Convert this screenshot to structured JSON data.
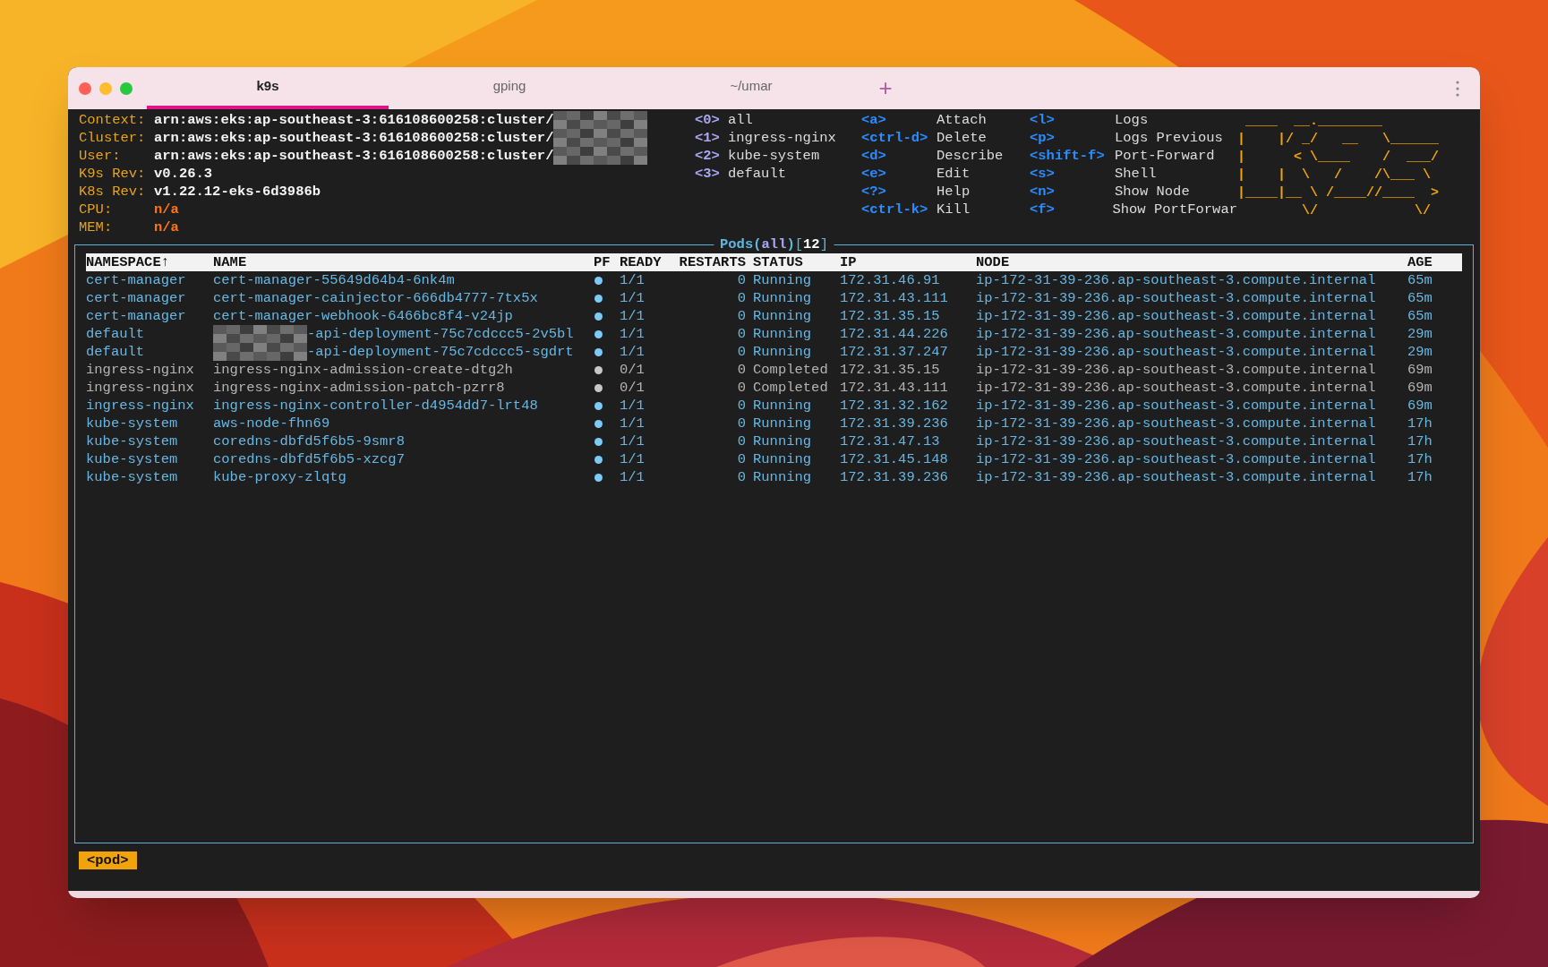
{
  "tabs": [
    {
      "label": "k9s",
      "selected": true
    },
    {
      "label": "gping",
      "selected": false
    },
    {
      "label": "~/umar",
      "selected": false
    }
  ],
  "new_tab": "+",
  "info": [
    {
      "label": "Context:",
      "value": "arn:aws:eks:ap-southeast-3:616108600258:cluster/",
      "kind": "plain",
      "redacted": true
    },
    {
      "label": "Cluster:",
      "value": "arn:aws:eks:ap-southeast-3:616108600258:cluster/",
      "kind": "plain",
      "redacted": true
    },
    {
      "label": "User:",
      "value": "arn:aws:eks:ap-southeast-3:616108600258:cluster/",
      "kind": "plain",
      "redacted": true
    },
    {
      "label": "K9s Rev:",
      "value": "v0.26.3",
      "kind": "plain",
      "redacted": false
    },
    {
      "label": "K8s Rev:",
      "value": "v1.22.12-eks-6d3986b",
      "kind": "plain",
      "redacted": false
    },
    {
      "label": "CPU:",
      "value": "n/a",
      "kind": "metric",
      "redacted": false
    },
    {
      "label": "MEM:",
      "value": "n/a",
      "kind": "metric",
      "redacted": false
    }
  ],
  "namespaces": [
    {
      "key": "<0>",
      "name": "all"
    },
    {
      "key": "<1>",
      "name": "ingress-nginx"
    },
    {
      "key": "<2>",
      "name": "kube-system"
    },
    {
      "key": "<3>",
      "name": "default"
    }
  ],
  "shortcuts": [
    [
      {
        "key": "<a>",
        "action": "Attach"
      },
      {
        "key": "<ctrl-d>",
        "action": "Delete"
      },
      {
        "key": "<d>",
        "action": "Describe"
      },
      {
        "key": "<e>",
        "action": "Edit"
      },
      {
        "key": "<?>",
        "action": "Help"
      },
      {
        "key": "<ctrl-k>",
        "action": "Kill"
      }
    ],
    [
      {
        "key": "<l>",
        "action": "Logs"
      },
      {
        "key": "<p>",
        "action": "Logs Previous"
      },
      {
        "key": "<shift-f>",
        "action": "Port-Forward"
      },
      {
        "key": "<s>",
        "action": "Shell"
      },
      {
        "key": "<n>",
        "action": "Show Node"
      },
      {
        "key": "<f>",
        "action": "Show PortForwar"
      }
    ]
  ],
  "logo": [
    " ____  __.________       ",
    "|    |/ _/   __   \\______ ",
    "|      < \\____    /  ___/ ",
    "|    |  \\   /    /\\___ \\  ",
    "|____|__ \\ /____//____  > ",
    "        \\/            \\/  "
  ],
  "pods": {
    "title": [
      {
        "text": "Pods",
        "kind": "name"
      },
      {
        "text": "(",
        "kind": "bracket"
      },
      {
        "text": "all",
        "kind": "filter"
      },
      {
        "text": ")",
        "kind": "bracket"
      },
      {
        "text": "[",
        "kind": "plain"
      },
      {
        "text": "12",
        "kind": "count"
      },
      {
        "text": "]",
        "kind": "plain"
      }
    ],
    "columns": [
      "NAMESPACE↑",
      "NAME",
      "PF",
      "READY",
      "RESTARTS",
      "STATUS",
      "IP",
      "NODE",
      "AGE"
    ],
    "rows": [
      {
        "namespace": "cert-manager",
        "name": "cert-manager-55649d64b4-6nk4m",
        "name_redacted": false,
        "ready": "1/1",
        "restarts": "0",
        "status": "Running",
        "ip": "172.31.46.91",
        "node": "ip-172-31-39-236.ap-southeast-3.compute.internal",
        "age": "65m",
        "completed": false
      },
      {
        "namespace": "cert-manager",
        "name": "cert-manager-cainjector-666db4777-7tx5x",
        "name_redacted": false,
        "ready": "1/1",
        "restarts": "0",
        "status": "Running",
        "ip": "172.31.43.111",
        "node": "ip-172-31-39-236.ap-southeast-3.compute.internal",
        "age": "65m",
        "completed": false
      },
      {
        "namespace": "cert-manager",
        "name": "cert-manager-webhook-6466bc8f4-v24jp",
        "name_redacted": false,
        "ready": "1/1",
        "restarts": "0",
        "status": "Running",
        "ip": "172.31.35.15",
        "node": "ip-172-31-39-236.ap-southeast-3.compute.internal",
        "age": "65m",
        "completed": false
      },
      {
        "namespace": "default",
        "name": "-api-deployment-75c7cdccc5-2v5bl",
        "name_redacted": true,
        "ready": "1/1",
        "restarts": "0",
        "status": "Running",
        "ip": "172.31.44.226",
        "node": "ip-172-31-39-236.ap-southeast-3.compute.internal",
        "age": "29m",
        "completed": false
      },
      {
        "namespace": "default",
        "name": "-api-deployment-75c7cdccc5-sgdrt",
        "name_redacted": true,
        "ready": "1/1",
        "restarts": "0",
        "status": "Running",
        "ip": "172.31.37.247",
        "node": "ip-172-31-39-236.ap-southeast-3.compute.internal",
        "age": "29m",
        "completed": false
      },
      {
        "namespace": "ingress-nginx",
        "name": "ingress-nginx-admission-create-dtg2h",
        "name_redacted": false,
        "ready": "0/1",
        "restarts": "0",
        "status": "Completed",
        "ip": "172.31.35.15",
        "node": "ip-172-31-39-236.ap-southeast-3.compute.internal",
        "age": "69m",
        "completed": true
      },
      {
        "namespace": "ingress-nginx",
        "name": "ingress-nginx-admission-patch-pzrr8",
        "name_redacted": false,
        "ready": "0/1",
        "restarts": "0",
        "status": "Completed",
        "ip": "172.31.43.111",
        "node": "ip-172-31-39-236.ap-southeast-3.compute.internal",
        "age": "69m",
        "completed": true
      },
      {
        "namespace": "ingress-nginx",
        "name": "ingress-nginx-controller-d4954dd7-lrt48",
        "name_redacted": false,
        "ready": "1/1",
        "restarts": "0",
        "status": "Running",
        "ip": "172.31.32.162",
        "node": "ip-172-31-39-236.ap-southeast-3.compute.internal",
        "age": "69m",
        "completed": false
      },
      {
        "namespace": "kube-system",
        "name": "aws-node-fhn69",
        "name_redacted": false,
        "ready": "1/1",
        "restarts": "0",
        "status": "Running",
        "ip": "172.31.39.236",
        "node": "ip-172-31-39-236.ap-southeast-3.compute.internal",
        "age": "17h",
        "completed": false
      },
      {
        "namespace": "kube-system",
        "name": "coredns-dbfd5f6b5-9smr8",
        "name_redacted": false,
        "ready": "1/1",
        "restarts": "0",
        "status": "Running",
        "ip": "172.31.47.13",
        "node": "ip-172-31-39-236.ap-southeast-3.compute.internal",
        "age": "17h",
        "completed": false
      },
      {
        "namespace": "kube-system",
        "name": "coredns-dbfd5f6b5-xzcg7",
        "name_redacted": false,
        "ready": "1/1",
        "restarts": "0",
        "status": "Running",
        "ip": "172.31.45.148",
        "node": "ip-172-31-39-236.ap-southeast-3.compute.internal",
        "age": "17h",
        "completed": false
      },
      {
        "namespace": "kube-system",
        "name": "kube-proxy-zlqtg",
        "name_redacted": false,
        "ready": "1/1",
        "restarts": "0",
        "status": "Running",
        "ip": "172.31.39.236",
        "node": "ip-172-31-39-236.ap-southeast-3.compute.internal",
        "age": "17h",
        "completed": false
      }
    ]
  },
  "crumb": "<pod>"
}
